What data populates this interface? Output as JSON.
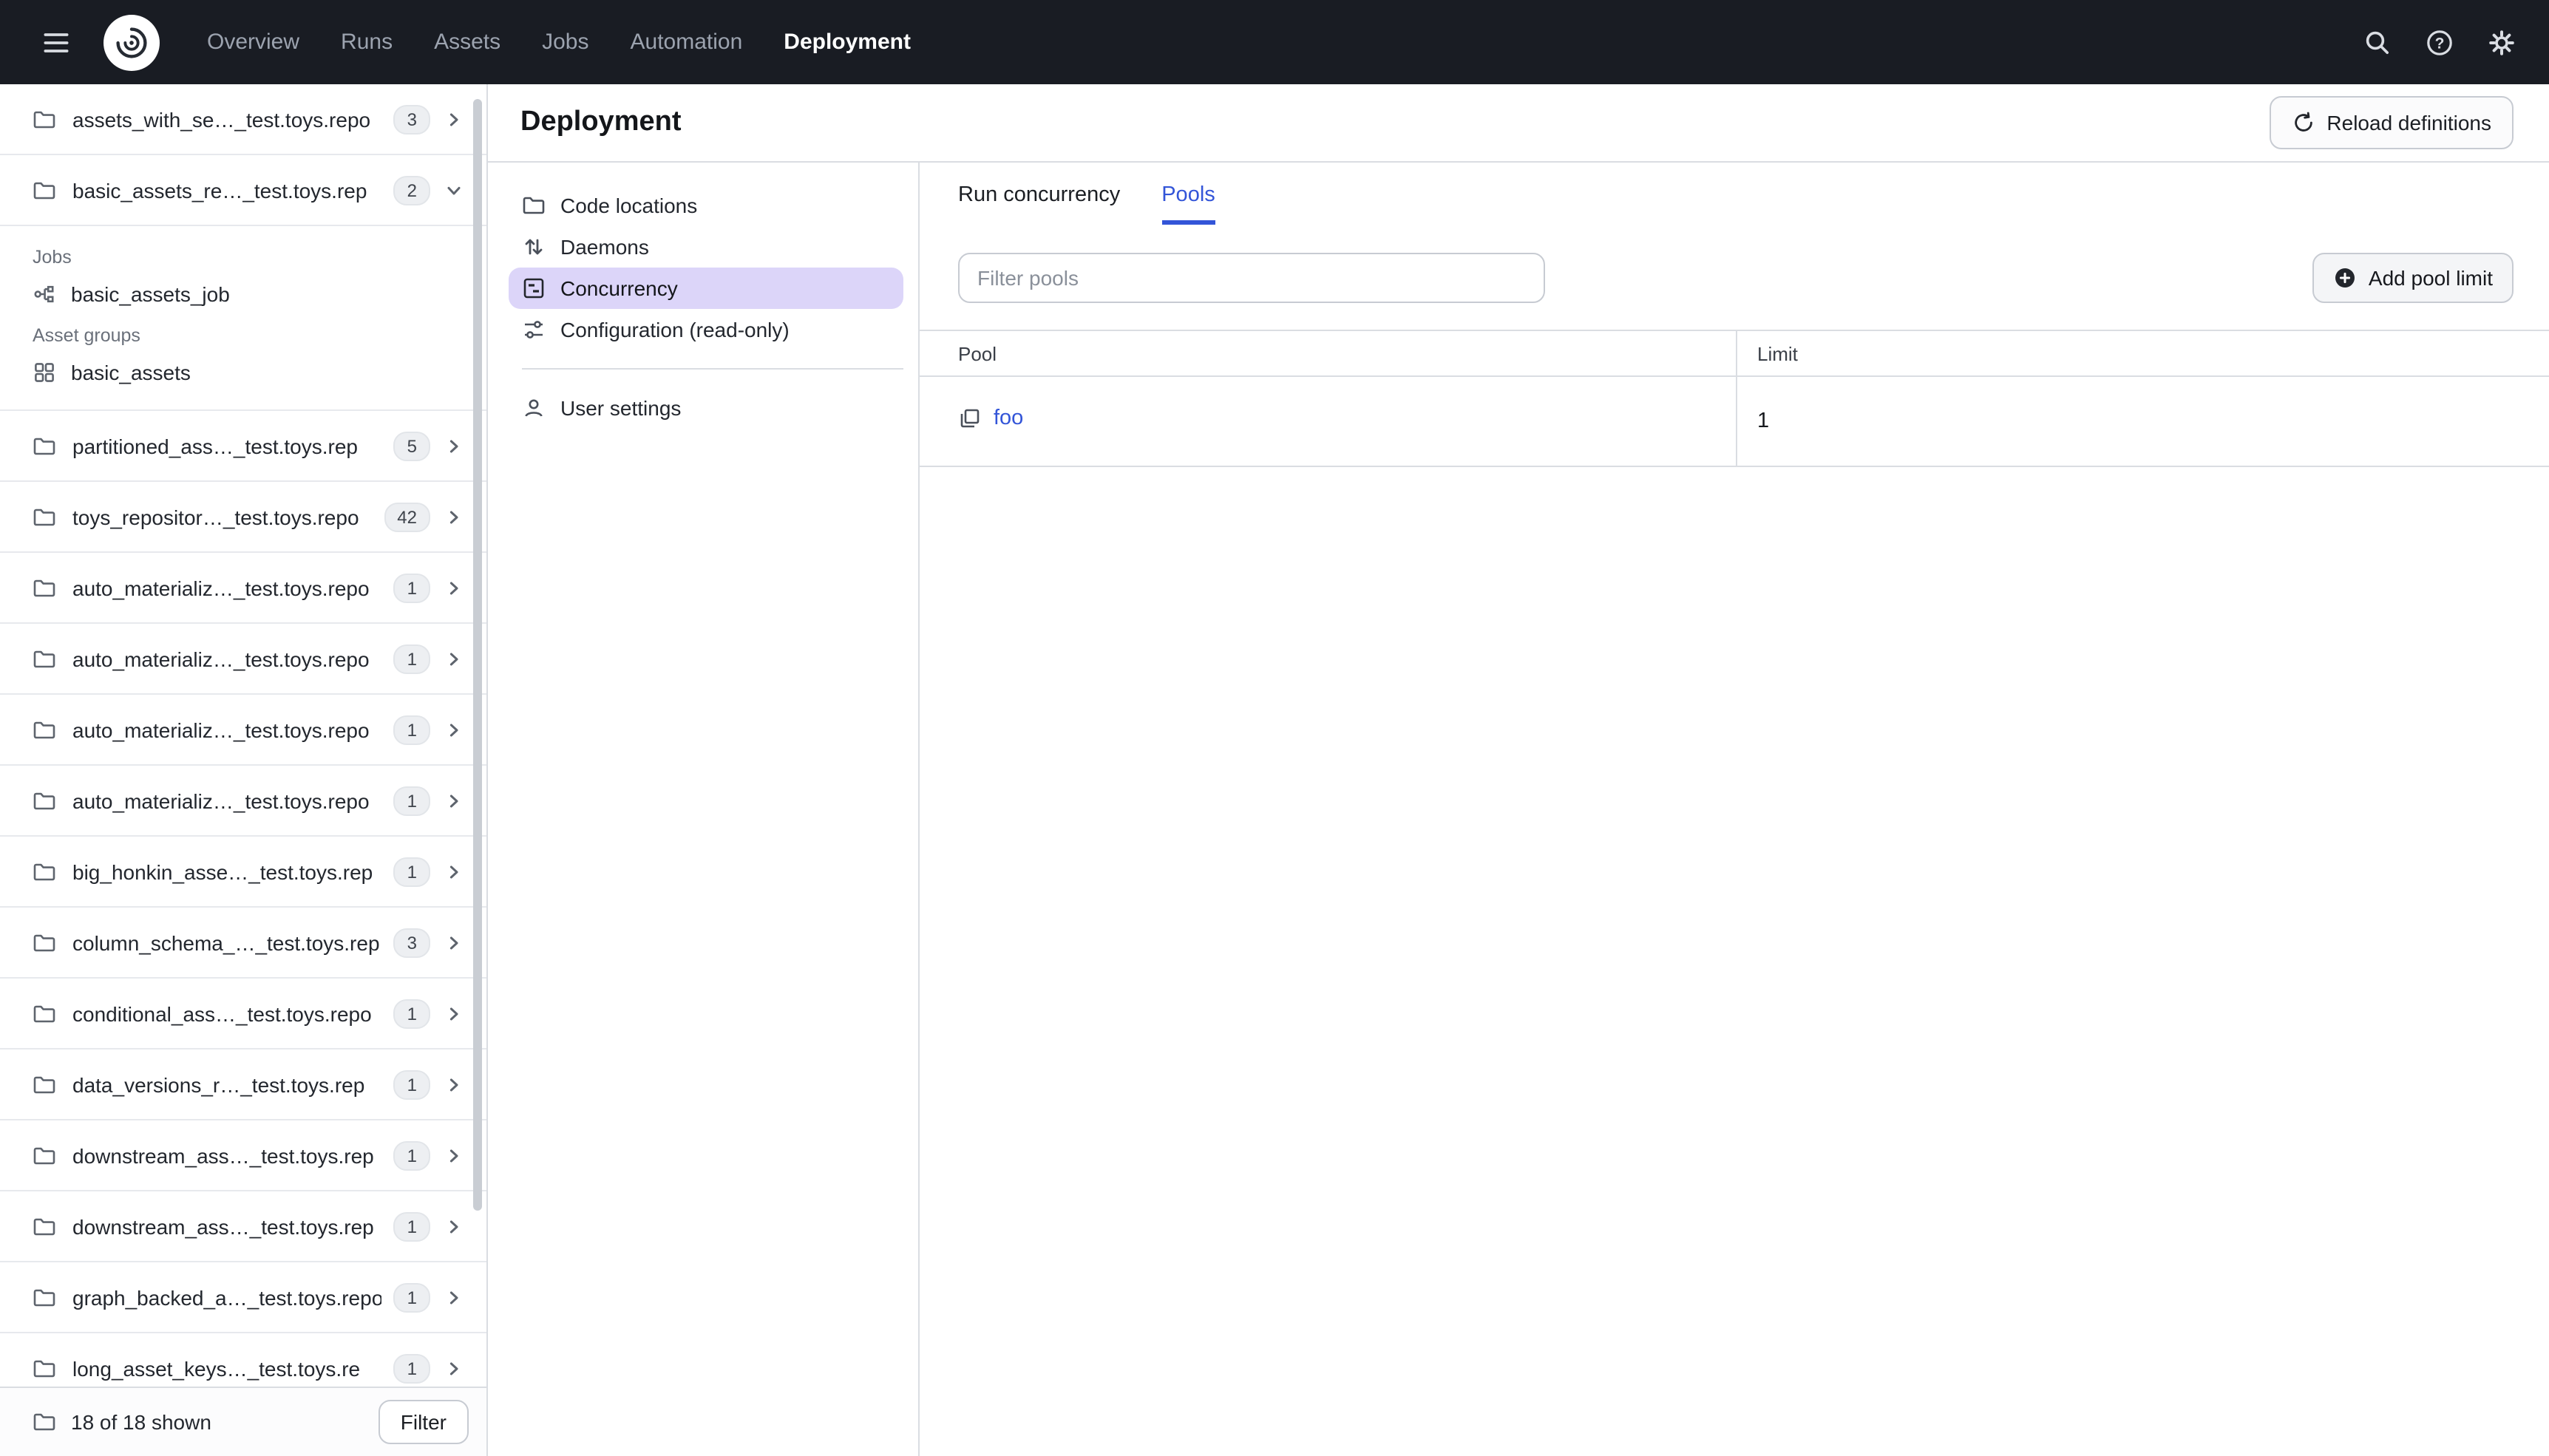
{
  "colors": {
    "topnav_bg": "#191C23",
    "accent_blue": "#3355D8",
    "selected_purple": "#DCD5F9",
    "border": "#DADDE2",
    "text_dark": "#181B20"
  },
  "topnav": {
    "items": [
      "Overview",
      "Runs",
      "Assets",
      "Jobs",
      "Automation",
      "Deployment"
    ],
    "active_item": "Deployment"
  },
  "sidebar": {
    "repos": [
      {
        "name": "assets_with_se…_test.toys.repo",
        "count": "3",
        "expanded": false
      },
      {
        "name": "basic_assets_re…_test.toys.rep",
        "count": "2",
        "expanded": true,
        "jobs_label": "Jobs",
        "jobs": [
          "basic_assets_job"
        ],
        "groups_label": "Asset groups",
        "groups": [
          "basic_assets"
        ]
      },
      {
        "name": "partitioned_ass…_test.toys.rep",
        "count": "5",
        "expanded": false
      },
      {
        "name": "toys_repositor…_test.toys.repo",
        "count": "42",
        "expanded": false
      },
      {
        "name": "auto_materializ…_test.toys.repo",
        "count": "1",
        "expanded": false
      },
      {
        "name": "auto_materializ…_test.toys.repo",
        "count": "1",
        "expanded": false
      },
      {
        "name": "auto_materializ…_test.toys.repo",
        "count": "1",
        "expanded": false
      },
      {
        "name": "auto_materializ…_test.toys.repo",
        "count": "1",
        "expanded": false
      },
      {
        "name": "big_honkin_asse…_test.toys.rep",
        "count": "1",
        "expanded": false
      },
      {
        "name": "column_schema_…_test.toys.rep",
        "count": "3",
        "expanded": false
      },
      {
        "name": "conditional_ass…_test.toys.repo",
        "count": "1",
        "expanded": false
      },
      {
        "name": "data_versions_r…_test.toys.rep",
        "count": "1",
        "expanded": false
      },
      {
        "name": "downstream_ass…_test.toys.rep",
        "count": "1",
        "expanded": false
      },
      {
        "name": "downstream_ass…_test.toys.rep",
        "count": "1",
        "expanded": false
      },
      {
        "name": "graph_backed_a…_test.toys.repo",
        "count": "1",
        "expanded": false
      },
      {
        "name": "long_asset_keys…_test.toys.re",
        "count": "1",
        "expanded": false
      }
    ],
    "footer": {
      "shown_text": "18 of 18 shown",
      "filter_button": "Filter"
    }
  },
  "main": {
    "title": "Deployment",
    "reload_button": "Reload definitions",
    "settings_nav": [
      {
        "label": "Code locations",
        "icon": "folder-icon",
        "selected": false
      },
      {
        "label": "Daemons",
        "icon": "daemon-icon",
        "selected": false
      },
      {
        "label": "Concurrency",
        "icon": "concurrency-icon",
        "selected": true
      },
      {
        "label": "Configuration (read-only)",
        "icon": "sliders-icon",
        "selected": false
      }
    ],
    "settings_nav_secondary": [
      {
        "label": "User settings",
        "icon": "user-icon"
      }
    ],
    "tabs": [
      {
        "label": "Run concurrency",
        "active": false
      },
      {
        "label": "Pools",
        "active": true
      }
    ],
    "filter_placeholder": "Filter pools",
    "add_pool_button": "Add pool limit",
    "pools_table": {
      "columns": [
        "Pool",
        "Limit"
      ],
      "rows": [
        {
          "pool": "foo",
          "limit": "1"
        }
      ]
    }
  }
}
